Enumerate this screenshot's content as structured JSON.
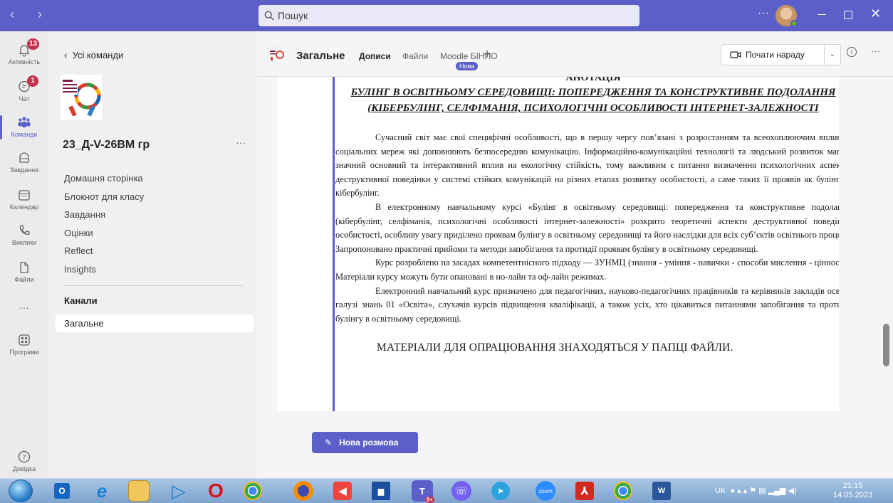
{
  "titlebar": {
    "search_placeholder": "Пошук",
    "more": "···"
  },
  "rail": {
    "items": [
      {
        "label": "Активність",
        "icon": "bell-icon",
        "badge": "13"
      },
      {
        "label": "Чат",
        "icon": "chat-icon",
        "badge": "1"
      },
      {
        "label": "Команди",
        "icon": "teams-icon",
        "badge": ""
      },
      {
        "label": "Завдання",
        "icon": "assignments-icon",
        "badge": ""
      },
      {
        "label": "Календар",
        "icon": "calendar-icon",
        "badge": ""
      },
      {
        "label": "Виклики",
        "icon": "phone-icon",
        "badge": ""
      },
      {
        "label": "Файли",
        "icon": "file-icon",
        "badge": ""
      },
      {
        "label": "Програми",
        "icon": "apps-icon",
        "badge": ""
      },
      {
        "label": "Довідка",
        "icon": "help-icon",
        "badge": ""
      }
    ],
    "more": "···"
  },
  "teampanel": {
    "back_label": "Усі команди",
    "team_name": "23_Д-V-26ВМ гр",
    "more": "···",
    "nav": [
      "Домашня сторінка",
      "Блокнот для класу",
      "Завдання",
      "Оцінки",
      "Reflect",
      "Insights"
    ],
    "channels_heading": "Канали",
    "channel": "Загальне"
  },
  "channel": {
    "title": "Загальне",
    "tabs": [
      "Дописи",
      "Файли",
      "Moodle БІНПО"
    ],
    "new_badge": "Нова",
    "meet_button": "Почати нараду",
    "new_conversation": "Нова розмова"
  },
  "post": {
    "heading": "АНОТАЦІЯ",
    "title": "БУЛІНГ В ОСВІТНЬОМУ СЕРЕДОВИЩІ: ПОПЕРЕДЖЕННЯ ТА КОНСТРУКТИВНЕ ПОДОЛАННЯ (КІБЕРБУЛІНГ, СЕЛФІМАНІЯ, ПСИХОЛОГІЧНІ ОСОБЛИВОСТІ ІНТЕРНЕТ-ЗАЛЕЖНОСТІ",
    "paragraphs": [
      "Сучасний світ має свої специфічні особливості, що в першу чергу пов’язані з розростанням та всеохоплюючим впливом соціальних мереж які доповнюють безпосередню комунікацію. Інформаційно-комунікаційні технології та людський розвиток мають значний основний та інтерактивний вплив на екологічну стійкість, тому важливим є питання визначення психологічних аспектів деструктивної поведінки у системі стійких комунікацій на різних етапах розвитку особистості, а саме таких її проявів як булінг та кібербулінг.",
      "В електронному навчальному курсі «Булінг в освітньому середовищі: попередження та конструктивне подолання (кібербулінг, селфіманія, психологічні особливості інтернет-залежності» розкрито теоретичні аспекти деструктивної поведінки особистості, особливу увагу приділено проявам булінгу в освітньому середовищі та його наслідки для всіх суб’єктів освітнього процесу. Запропоновано практичні прийоми та методи запобігання та протидії проявам булінгу в освітньому середовищі.",
      "Курс розроблено на засадах компетентнісного підходу — ЗУНМЦ (знання - уміння - навички - способи мислення - цінності). Матеріали курсу можуть бути опановані в но-лайн та оф-лайн режимах.",
      "Електронний навчальний курс призначено для педагогічних, науково-педагогічних працівників та керівників закладів освіти галузі знань 01 «Освіта», слухачів курсів підвищення кваліфікації, а також усіх, хто цікавиться питаннями запобігання та протидії булінгу в освітньому середовищі."
    ],
    "footer": "МАТЕРІАЛИ ДЛЯ ОПРАЦЮВАННЯ ЗНАХОДЯТЬСЯ У ПАПЦІ ФАЙЛИ."
  },
  "taskbar": {
    "apps": [
      "start-orb",
      "outlook-icon",
      "ie-icon",
      "explorer-icon",
      "media-player-icon",
      "opera-icon",
      "chrome-icon",
      "firefox-icon",
      "anydesk-icon",
      "save-icon",
      "teams-icon",
      "viber-icon",
      "telegram-icon",
      "zoom-icon",
      "acrobat-icon",
      "chrome-alt-icon",
      "word-icon"
    ],
    "teams_badge": "9+",
    "zoom_label": "zoom",
    "lang": "UK",
    "time": "21:15",
    "date": "14.05.2023"
  }
}
